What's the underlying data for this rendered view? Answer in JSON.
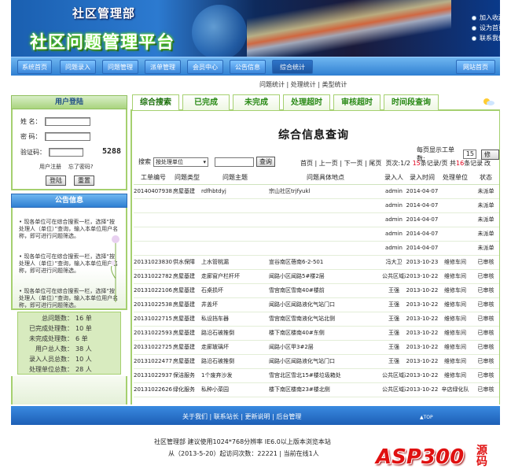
{
  "header": {
    "brand_top": "社区管理部",
    "brand_main": "社区问题管理平台",
    "quick_links": [
      "加入收藏",
      "设为首页",
      "联系我们"
    ]
  },
  "nav": {
    "items": [
      "系统首页",
      "问题录入",
      "问题管理",
      "派单管理",
      "会员中心",
      "公告信息",
      "综合统计"
    ],
    "active": "综合统计",
    "right": "网站首页"
  },
  "subnav": "问题统计 | 处理统计 | 类型统计",
  "login": {
    "title": "用户登陆",
    "name_label": "姓  名：",
    "password_label": "密  码：",
    "captcha_label": "验证码：",
    "captcha_code": "5288",
    "register": "用户注册",
    "forgot": "忘了密码?",
    "login_btn": "登陆",
    "reset_btn": "重置"
  },
  "notice": {
    "title": "公告信息",
    "items": [
      "• 现各单位可在综合搜索一栏，选择“按处理人（单位）”查询，输入本单位用户名称，即可进行问题筛选。",
      "• 现各单位可在综合搜索一栏，选择“按处理人（单位）”查询，输入本单位用户名称，即可进行问题筛选。",
      "• 现各单位可在综合搜索一栏，选择“按处理人（单位）”查询，输入本单位用户名称，即可进行问题筛选。"
    ]
  },
  "stats": [
    {
      "k": "总问题数：",
      "v": "16 单"
    },
    {
      "k": "已完成处理数：",
      "v": "10 单"
    },
    {
      "k": "未完成处理数：",
      "v": "6 单"
    },
    {
      "k": "用户总人数：",
      "v": "38 人"
    },
    {
      "k": "录入人员总数：",
      "v": "10 人"
    },
    {
      "k": "处理单位总数：",
      "v": "28 人"
    }
  ],
  "tabs": [
    "综合搜索",
    "已完成",
    "未完成",
    "处理超时",
    "审核超时",
    "时间段查询"
  ],
  "main": {
    "title": "综合信息查询",
    "perpage_label": "每页显示工单数:",
    "perpage_value": "15",
    "modify": "修改",
    "search_label": "搜索",
    "search_select": "按处理单位",
    "search_btn": "查询",
    "pager_first": "首页",
    "pager_prev": "上一页",
    "pager_next": "下一页",
    "pager_last": "尾页",
    "pager_info_a": "页次:1/2",
    "pager_info_b": "15",
    "pager_info_c": "条记录/页 共",
    "pager_info_d": "16",
    "pager_info_e": "条记录"
  },
  "table": {
    "headers": [
      "工单编号",
      "问题类型",
      "问题主题",
      "问题具体地点",
      "录入人",
      "录入时间",
      "处理单位",
      "状态"
    ],
    "rows": [
      [
        "20140407938",
        "房屋基建",
        "rdfhbtdyj",
        "宗山社区trjfyukl",
        "admin",
        "2014-04-07",
        "",
        "未派单"
      ],
      [
        "",
        "",
        "",
        "",
        "admin",
        "2014-04-07",
        "",
        "未派单"
      ],
      [
        "",
        "",
        "",
        "",
        "admin",
        "2014-04-07",
        "",
        "未派单"
      ],
      [
        "",
        "",
        "",
        "",
        "admin",
        "2014-04-07",
        "",
        "未派单"
      ],
      [
        "",
        "",
        "",
        "",
        "admin",
        "2014-04-07",
        "",
        "未派单"
      ],
      [
        "20131023830",
        "供水保障",
        "上水管桃漏",
        "宣谷南区蓓南6-2-501",
        "冯大卫",
        "2013-10-23",
        "维修车间",
        "已审核"
      ],
      [
        "20131022782",
        "房屋基建",
        "走廊窗户栏杆坏",
        "闻路小区闻路5#楼2层",
        "公共区域巡检",
        "2013-10-22",
        "维修车间",
        "已审核"
      ],
      [
        "20131022106",
        "房屋基建",
        "石桌损坏",
        "雪宫南区雪南40#楼前",
        "王强",
        "2013-10-22",
        "维修车间",
        "已审核"
      ],
      [
        "20131022538",
        "房屋基建",
        "井盖坏",
        "闻路小区闻路液化气站门口",
        "王强",
        "2013-10-22",
        "维修车间",
        "已审核"
      ],
      [
        "20131022715",
        "房屋基建",
        "私设挡车器",
        "雪宫南区雪南液化气站北侧",
        "王强",
        "2013-10-22",
        "维修车间",
        "已审核"
      ],
      [
        "20131022593",
        "房屋基建",
        "路沿石被推倒",
        "楼下南区楼南40#东侧",
        "王强",
        "2013-10-22",
        "维修车间",
        "已审核"
      ],
      [
        "20131022725",
        "房屋基建",
        "走廊玻璃坏",
        "闻路小区甲3#2层",
        "王强",
        "2013-10-22",
        "维修车间",
        "已审核"
      ],
      [
        "20131022477",
        "房屋基建",
        "路沿石被推倒",
        "闻路小区闻路液化气站门口",
        "王强",
        "2013-10-22",
        "维修车间",
        "已审核"
      ],
      [
        "20131022937",
        "保洁服务",
        "1个废弃沙发",
        "雪宫北区雪北15#楼垃圾箱处",
        "公共区域巡检",
        "2013-10-22",
        "维修车间",
        "已审核"
      ],
      [
        "20131022626",
        "绿化服务",
        "私种小菜园",
        "楼下南区楼南23#楼北侧",
        "公共区域巡检",
        "2013-10-22",
        "辛店绿化队",
        "已审核"
      ]
    ]
  },
  "footer": {
    "links": "关于我们  |  联系站长  |  更新说明  |  后台管理",
    "top": "▲TOP",
    "copy1": "社区管理部  建议使用1024*768分辨率  IE6.0以上版本浏览本站",
    "copy2": "从（2013-5-20）起访问次数：22221  |  当前在线1人",
    "watermark": "ASP300",
    "watermark_cn": "源码"
  },
  "colors": {
    "brand_blue": "#2f7fd2",
    "panel_green": "#a5d06f",
    "status_pending": "#d100c0",
    "pager_red": "#e0001b"
  }
}
